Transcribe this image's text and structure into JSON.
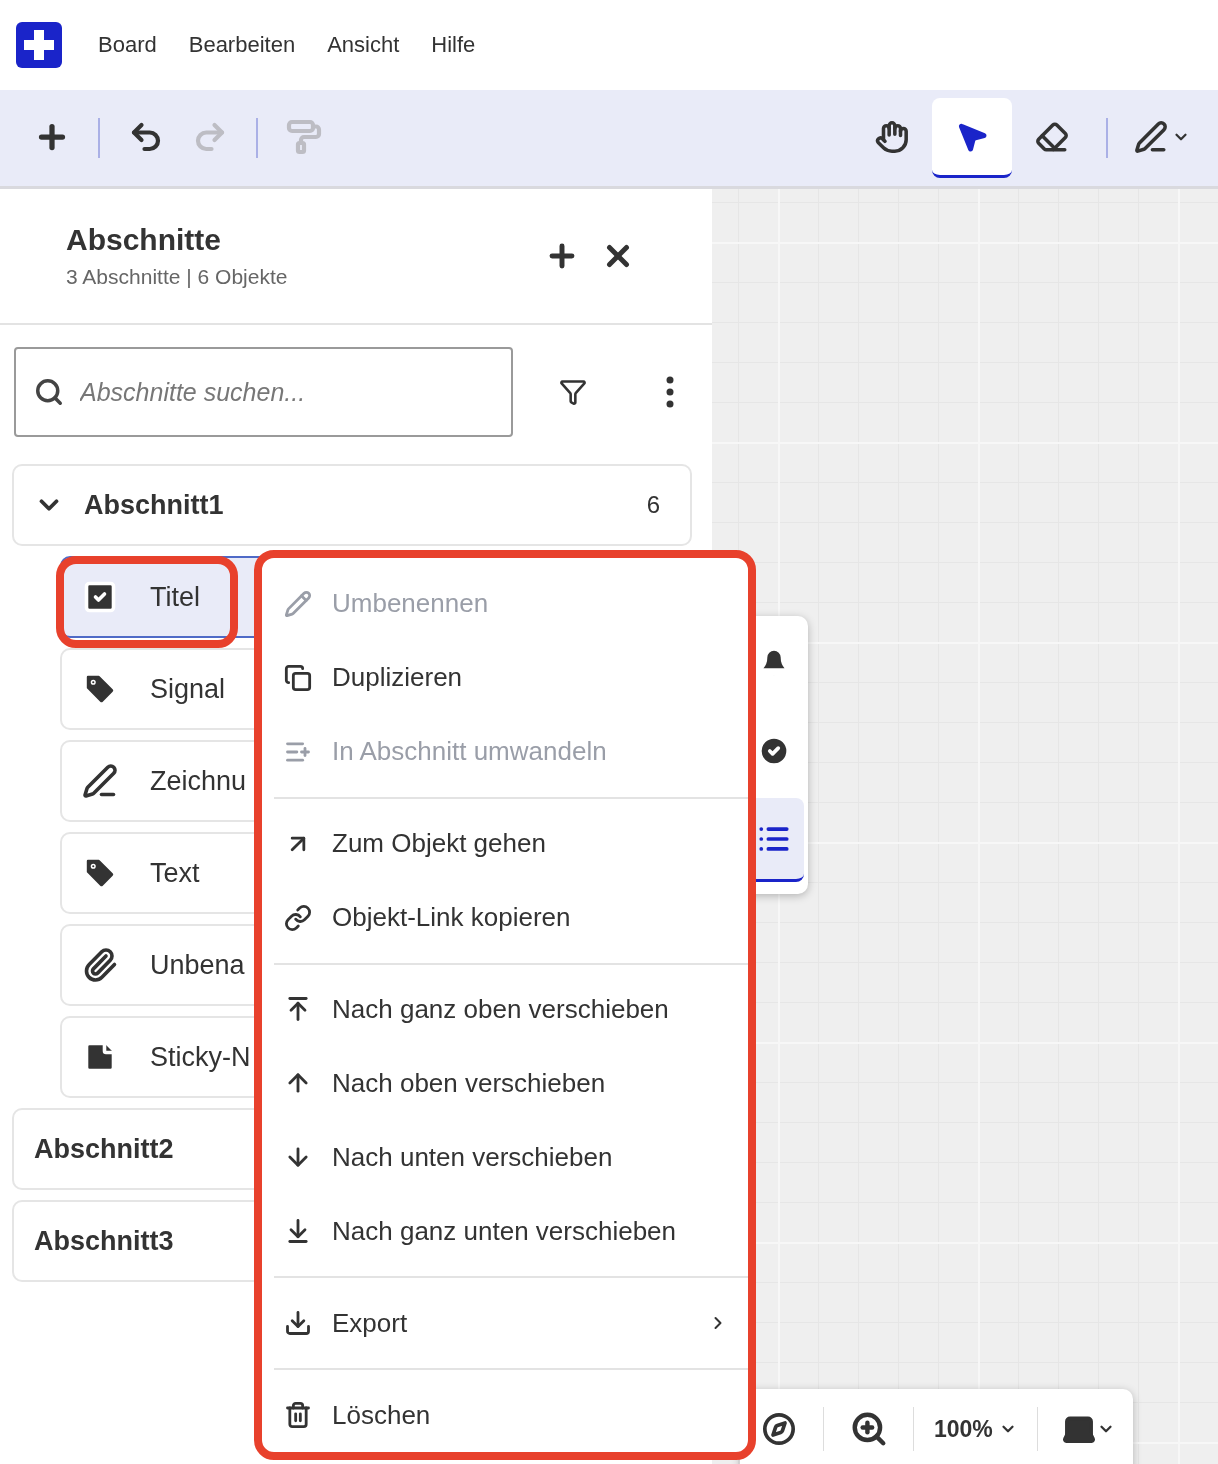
{
  "menu_bar": {
    "items": [
      "Board",
      "Bearbeiten",
      "Ansicht",
      "Hilfe"
    ]
  },
  "toolbar": {
    "left": [
      {
        "kind": "add",
        "disabled": false
      },
      {
        "kind": "undo",
        "disabled": false
      },
      {
        "kind": "redo",
        "disabled": true
      },
      {
        "kind": "format",
        "disabled": true
      }
    ],
    "tools": [
      {
        "kind": "hand",
        "selected": false
      },
      {
        "kind": "pointer",
        "selected": true
      },
      {
        "kind": "eraser",
        "selected": false
      },
      {
        "kind": "pen",
        "selected": false
      }
    ]
  },
  "sidebar": {
    "title": "Abschnitte",
    "subtitle": "3 Abschnitte | 6 Objekte",
    "search": {
      "placeholder": "Abschnitte suchen..."
    },
    "sections": [
      {
        "name": "Abschnitt1",
        "count": "6",
        "expanded": true,
        "children": [
          {
            "label": "Titel",
            "kind": "title",
            "selected": true
          },
          {
            "label": "Signal",
            "kind": "tag",
            "selected": false
          },
          {
            "label": "Zeichnu",
            "kind": "drawing",
            "selected": false
          },
          {
            "label": "Text",
            "kind": "tag",
            "selected": false
          },
          {
            "label": "Unbena",
            "kind": "attachment",
            "selected": false
          },
          {
            "label": "Sticky-N",
            "kind": "note",
            "selected": false
          }
        ]
      },
      {
        "name": "Abschnitt2",
        "expanded": false
      },
      {
        "name": "Abschnitt3",
        "expanded": false
      }
    ]
  },
  "side_panel": [
    {
      "kind": "bell",
      "selected": false
    },
    {
      "kind": "check",
      "selected": false
    },
    {
      "kind": "list",
      "selected": true
    }
  ],
  "bottom_bar": {
    "zoom": "100%"
  },
  "context_menu": {
    "groups": [
      [
        {
          "label": "Umbenennen",
          "kind": "rename",
          "disabled": true
        },
        {
          "label": "Duplizieren",
          "kind": "duplicate",
          "disabled": false
        },
        {
          "label": "In Abschnitt umwandeln",
          "kind": "convert",
          "disabled": true
        }
      ],
      [
        {
          "label": "Zum Objekt gehen",
          "kind": "goto",
          "disabled": false
        },
        {
          "label": "Objekt-Link kopieren",
          "kind": "link",
          "disabled": false
        }
      ],
      [
        {
          "label": "Nach ganz oben verschieben",
          "kind": "top",
          "disabled": false
        },
        {
          "label": "Nach oben verschieben",
          "kind": "up",
          "disabled": false
        },
        {
          "label": "Nach unten verschieben",
          "kind": "down",
          "disabled": false
        },
        {
          "label": "Nach ganz unten verschieben",
          "kind": "bottom",
          "disabled": false
        }
      ],
      [
        {
          "label": "Export",
          "kind": "export",
          "disabled": false,
          "submenu": true
        }
      ],
      [
        {
          "label": "Löschen",
          "kind": "delete",
          "disabled": false
        }
      ]
    ]
  }
}
